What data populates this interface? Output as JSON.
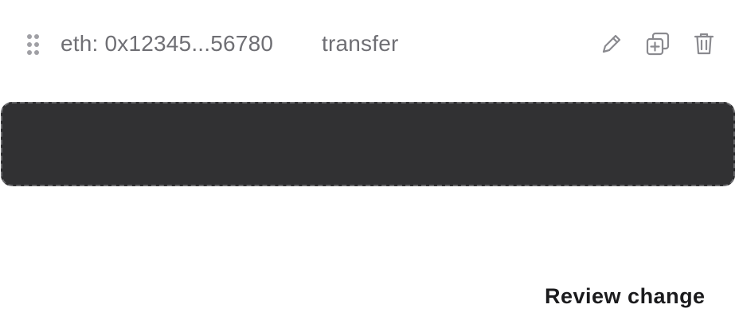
{
  "action_row": {
    "address": "eth: 0x12345...56780",
    "action": "transfer",
    "icons": {
      "drag": "drag-handle-icon",
      "edit": "pencil-icon",
      "duplicate": "duplicate-icon",
      "delete": "trash-icon"
    }
  },
  "drop_zone": {
    "fill_color": "#313133",
    "border_color": "#6b6b6e"
  },
  "footer": {
    "review_label": "Review change"
  },
  "colors": {
    "icon": "#8a8a8f",
    "muted_text": "#6f6f74",
    "strong_text": "#1b1b1d"
  }
}
